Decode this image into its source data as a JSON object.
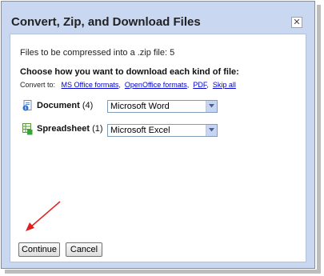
{
  "dialog": {
    "title": "Convert, Zip, and Download Files",
    "close_glyph": "✕"
  },
  "body": {
    "files_line": "Files to be compressed into a .zip file: 5",
    "heading": "Choose how you want to download each kind of file:",
    "convert_to_label": "Convert to:",
    "convert_links": [
      "MS Office formats",
      "OpenOffice formats",
      "PDF",
      "Skip all"
    ]
  },
  "rows": [
    {
      "label": "Document",
      "count": "(4)",
      "selected": "Microsoft Word",
      "icon": "document-icon"
    },
    {
      "label": "Spreadsheet",
      "count": "(1)",
      "selected": "Microsoft Excel",
      "icon": "spreadsheet-icon"
    }
  ],
  "buttons": {
    "continue_label": "Continue",
    "cancel_label": "Cancel"
  },
  "colors": {
    "frame": "#c9d7f1",
    "link": "#0000cc",
    "annotation_arrow": "#e02020"
  }
}
